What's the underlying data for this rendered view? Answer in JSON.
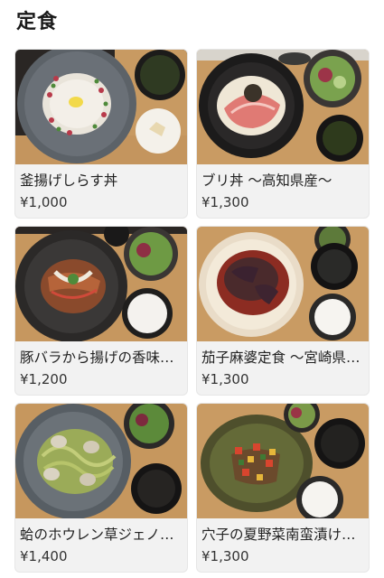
{
  "section": {
    "title": "定食"
  },
  "menu": {
    "items": [
      {
        "name": "釜揚げしらす丼",
        "price": "¥1,000"
      },
      {
        "name": "ブリ丼 〜高知県産〜",
        "price": "¥1,300"
      },
      {
        "name": "豚バラから揚げの香味ソース",
        "price": "¥1,200"
      },
      {
        "name": "茄子麻婆定食 〜宮崎県産〜",
        "price": "¥1,300"
      },
      {
        "name": "蛤のホウレン草ジェノベーゼ",
        "price": "¥1,400"
      },
      {
        "name": "穴子の夏野菜南蛮漬け定食",
        "price": "¥1,300"
      }
    ]
  }
}
